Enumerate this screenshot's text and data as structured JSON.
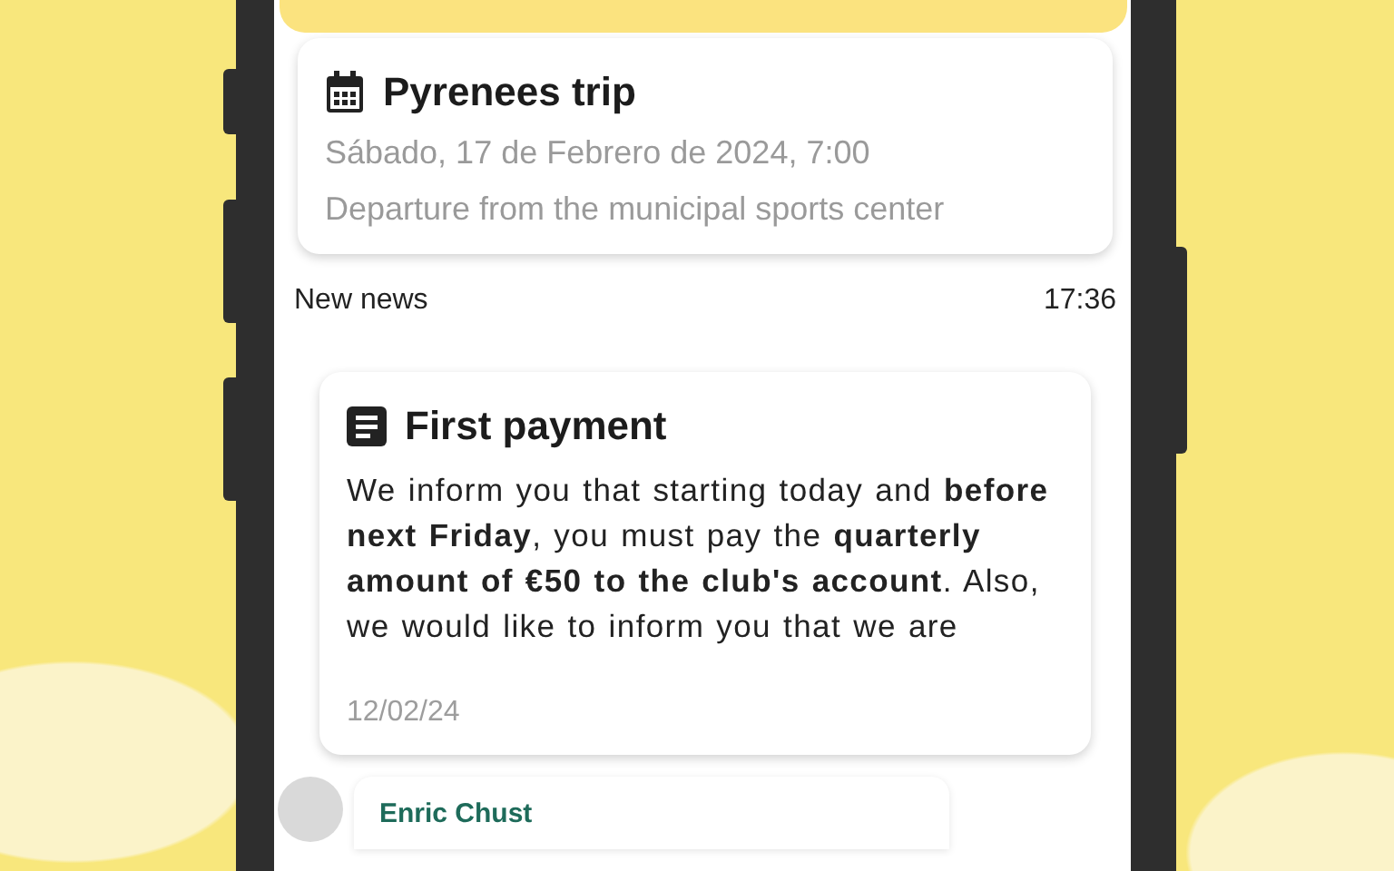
{
  "event_card": {
    "title": "Pyrenees trip",
    "date": "Sábado, 17 de Febrero de 2024, 7:00",
    "description": "Departure from the municipal sports center"
  },
  "news_header": {
    "label": "New news",
    "time": "17:36"
  },
  "message_card": {
    "title": "First payment",
    "body": "We inform you that starting today and **before next Friday**, you must pay the **quarterly amount of €50 to the club's account**. Also, we would like to inform you that we are",
    "date": "12/02/24"
  },
  "sender": {
    "name": "Enric Chust"
  }
}
